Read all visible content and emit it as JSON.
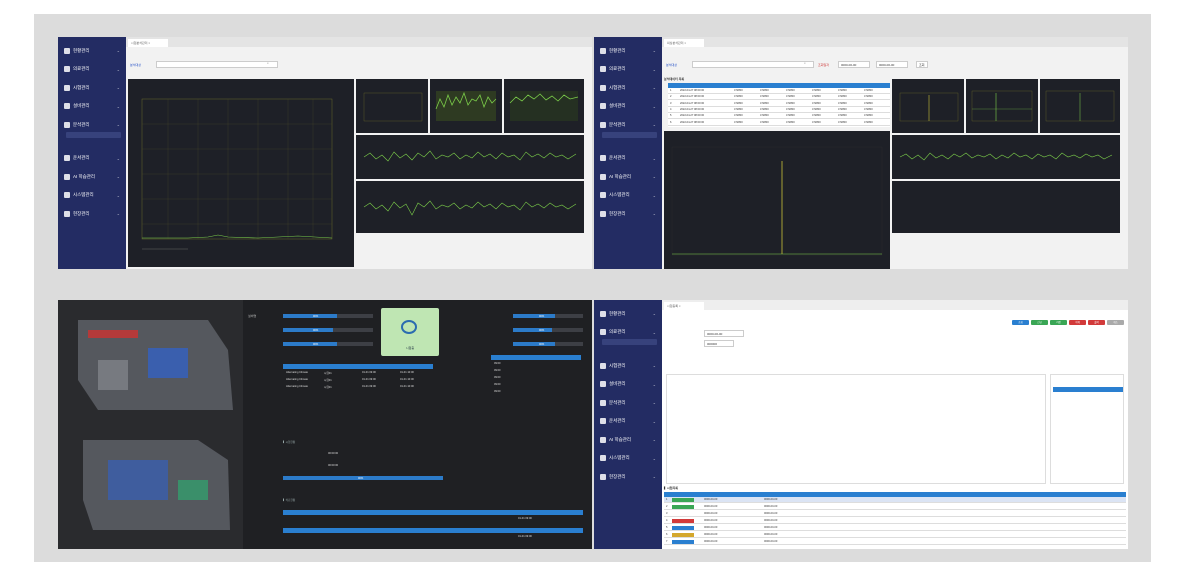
{
  "nav": [
    "현황관리",
    "의료관리",
    "시험관리",
    "설비관리",
    "분석관리",
    "운서관리",
    "AI 학습관리",
    "시스템관리",
    "현장관리"
  ],
  "colors": {
    "sidebar": "#232c63",
    "accent": "#2a7fd0",
    "dark_panel": "#1e2027",
    "chart_green": "#7ccf4a",
    "chart_yellow": "#c9c23a"
  },
  "q1": {
    "tab": "시험분석관리 ×",
    "filter_label": "분석대상",
    "search_icon": "search-icon"
  },
  "q2": {
    "tab": "외상분석관리 ×",
    "filter_label": "분석대상",
    "date_label": "조회일자",
    "date_from": "0000-00-00",
    "date_to": "0000-00-00",
    "search_btn": "조회",
    "table_title": "분석데이터 목록",
    "rows": [
      {
        "n": "1",
        "t": "2022-04-27 08:00:00",
        "v": [
          "472800",
          "472800",
          "472800",
          "472800",
          "472800",
          "472800"
        ]
      },
      {
        "n": "2",
        "t": "2022-04-27 08:00:00",
        "v": [
          "472800",
          "472800",
          "472800",
          "472800",
          "472800",
          "472800"
        ]
      },
      {
        "n": "3",
        "t": "2022-04-27 08:00:00",
        "v": [
          "472800",
          "472800",
          "472800",
          "472800",
          "472800",
          "472800"
        ]
      },
      {
        "n": "4",
        "t": "2022-04-27 08:00:00",
        "v": [
          "472800",
          "472800",
          "472800",
          "472800",
          "472800",
          "472800"
        ]
      },
      {
        "n": "5",
        "t": "2022-04-27 08:00:00",
        "v": [
          "472800",
          "472800",
          "472800",
          "472800",
          "472800",
          "472800"
        ]
      },
      {
        "n": "6",
        "t": "2022-04-27 08:00:00",
        "v": [
          "472800",
          "472800",
          "472800",
          "472800",
          "472800",
          "472800"
        ]
      }
    ]
  },
  "q3": {
    "status_button": "시험중",
    "bars_left": [
      {
        "pct": "90%",
        "level": 0.6
      },
      {
        "pct": "90%",
        "level": 0.55
      },
      {
        "pct": "90%",
        "level": 0.6
      }
    ],
    "bars_right": [
      {
        "pct": "90%",
        "level": 0.6
      },
      {
        "pct": "90%",
        "level": 0.55
      },
      {
        "pct": "90%",
        "level": 0.6
      }
    ],
    "list_rows": [
      [
        "Alternating Climate",
        "시험01",
        "01-01 09:00",
        "01-01 10:00"
      ],
      [
        "Alternating Climate",
        "시험01",
        "01-01 09:00",
        "01-01 10:00"
      ],
      [
        "Alternating Climate",
        "시험01",
        "01-01 09:00",
        "01-01 10:00"
      ]
    ],
    "time_rows": [
      "09:00",
      "09:00",
      "09:00",
      "09:00",
      "09:00"
    ],
    "times": [
      "00:00:00",
      "00:00:00"
    ],
    "progress_pct": "90%",
    "bottom_times": [
      "01-01 09:00",
      "01-01 09:00"
    ]
  },
  "q4": {
    "tab": "시험등록 ×",
    "buttons": [
      "조회",
      "신규",
      "저장",
      "삭제",
      "출력",
      "취소"
    ],
    "date": "0000-00-00",
    "code": "000000",
    "rows": [
      {
        "n": "1",
        "d1": "0000-00-00",
        "d2": "0000-00-00"
      },
      {
        "n": "2",
        "d1": "0000-00-00",
        "d2": "0000-00-00"
      },
      {
        "n": "3",
        "d1": "0000-00-00",
        "d2": "0000-00-00"
      },
      {
        "n": "4",
        "d1": "0000-00-00",
        "d2": "0000-00-00"
      },
      {
        "n": "5",
        "d1": "0000-00-00",
        "d2": "0000-00-00"
      },
      {
        "n": "6",
        "d1": "0000-00-00",
        "d2": "0000-00-00"
      },
      {
        "n": "7",
        "d1": "0000-00-00",
        "d2": "0000-00-00"
      }
    ]
  }
}
